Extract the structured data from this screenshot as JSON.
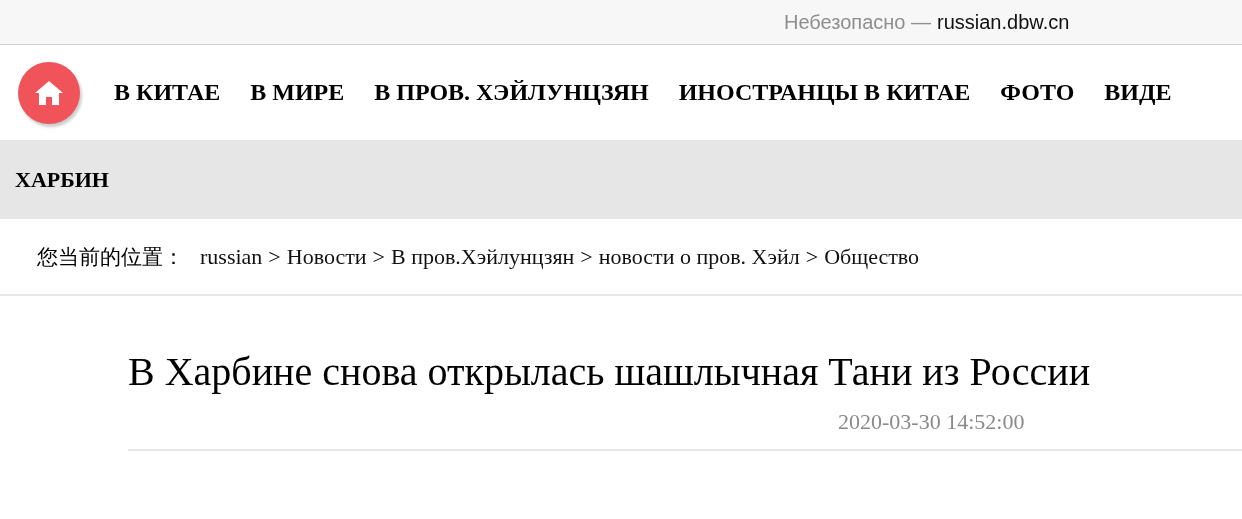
{
  "address_bar": {
    "security": "Небезопасно —",
    "url": "russian.dbw.cn"
  },
  "nav": {
    "items": [
      "В КИТАЕ",
      "В МИРЕ",
      "В ПРОВ. ХЭЙЛУНЦЗЯН",
      "ИНОСТРАНЦЫ В КИТАЕ",
      "ФОТО",
      "ВИДЕ"
    ]
  },
  "section": {
    "title": "ХАРБИН"
  },
  "breadcrumb": {
    "label": "您当前的位置：",
    "separator": ">",
    "items": [
      "russian",
      "Новости",
      "В пров.Хэйлунцзян",
      "новости о пров. Хэйл",
      "Общество"
    ]
  },
  "article": {
    "title": "В Харбине снова открылась шашлычная Тани из России",
    "date": "2020-03-30 14:52:00"
  }
}
